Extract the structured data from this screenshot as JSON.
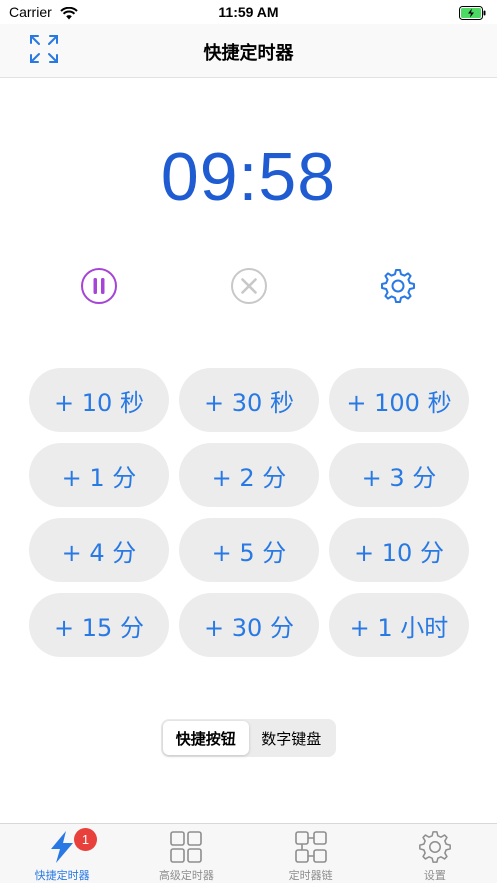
{
  "status_bar": {
    "carrier": "Carrier",
    "time": "11:59 AM",
    "wifi_icon": "wifi-icon",
    "battery_icon": "battery-charging-icon"
  },
  "nav": {
    "title": "快捷定时器",
    "expand_icon": "expand-arrows-icon"
  },
  "timer": {
    "display": "09:58",
    "color": "#1f5bd1"
  },
  "controls": {
    "pause_icon": "pause-circle-icon",
    "cancel_icon": "close-circle-icon",
    "settings_icon": "gear-icon",
    "pause_color": "#a544d6",
    "cancel_color": "#c8c8c8",
    "settings_color": "#2879e3"
  },
  "quick_add": {
    "buttons": [
      "+ 10 秒",
      "+ 30 秒",
      "+ 100 秒",
      "+ 1 分",
      "+ 2 分",
      "+ 3 分",
      "+ 4 分",
      "+ 5 分",
      "+ 10 分",
      "+ 15 分",
      "+ 30 分",
      "+ 1 小时"
    ],
    "text_color": "#2879e3"
  },
  "segmented": {
    "options": [
      "快捷按钮",
      "数字键盘"
    ],
    "selected": "快捷按钮"
  },
  "tab_bar": {
    "tabs": [
      {
        "label": "快捷定时器",
        "icon": "lightning-icon",
        "badge": "1",
        "active": true
      },
      {
        "label": "高级定时器",
        "icon": "grid-icon",
        "active": false
      },
      {
        "label": "定时器链",
        "icon": "chain-icon",
        "active": false
      },
      {
        "label": "设置",
        "icon": "gear-icon",
        "active": false
      }
    ],
    "active_color": "#2879e3",
    "badge_color": "#e8403a"
  }
}
